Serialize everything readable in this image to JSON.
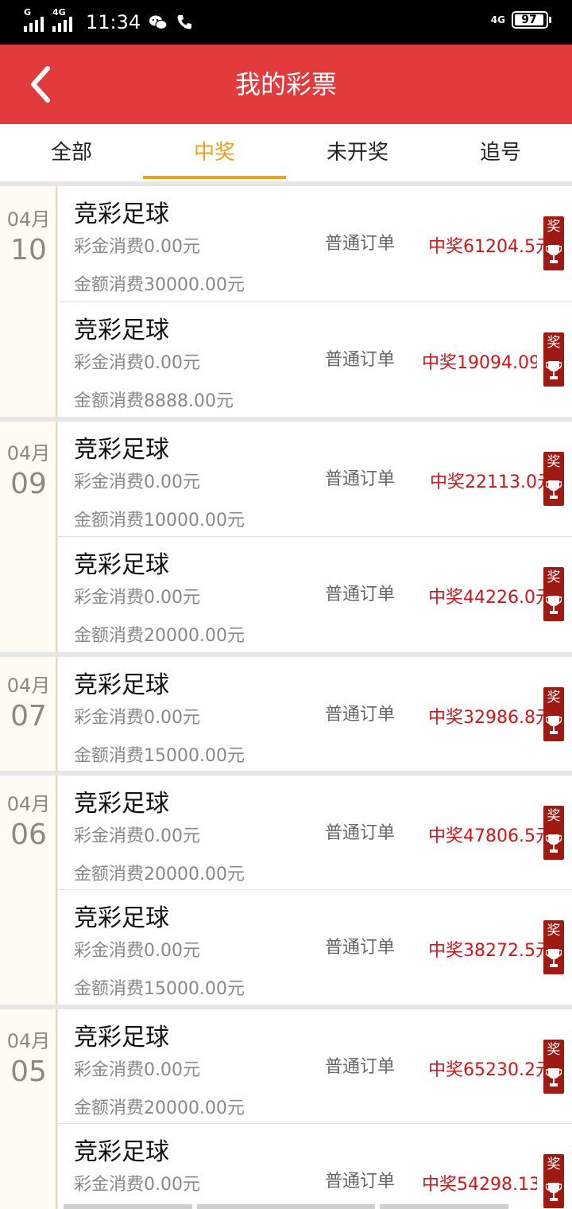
{
  "status_bar": {
    "time": "11:34",
    "signal1_label": "G",
    "signal2_label": "4G",
    "network": "4G",
    "battery": "97"
  },
  "header": {
    "title": "我的彩票"
  },
  "tabs": [
    {
      "label": "全部",
      "active": false
    },
    {
      "label": "中奖",
      "active": true
    },
    {
      "label": "未开奖",
      "active": false
    },
    {
      "label": "追号",
      "active": false
    }
  ],
  "groups": [
    {
      "month": "04月",
      "day": "10",
      "items": [
        {
          "title": "竞彩足球",
          "bonus": "彩金消费0.00元",
          "amount": "金额消费30000.00元",
          "order_type": "普通订单",
          "prize": "中奖61204.5元",
          "badge": "奖"
        },
        {
          "title": "竞彩足球",
          "bonus": "彩金消费0.00元",
          "amount": "金额消费8888.00元",
          "order_type": "普通订单",
          "prize": "中奖19094.09元",
          "badge": "奖"
        }
      ]
    },
    {
      "month": "04月",
      "day": "09",
      "items": [
        {
          "title": "竞彩足球",
          "bonus": "彩金消费0.00元",
          "amount": "金额消费10000.00元",
          "order_type": "普通订单",
          "prize": "中奖22113.0元",
          "badge": "奖"
        },
        {
          "title": "竞彩足球",
          "bonus": "彩金消费0.00元",
          "amount": "金额消费20000.00元",
          "order_type": "普通订单",
          "prize": "中奖44226.0元",
          "badge": "奖"
        }
      ]
    },
    {
      "month": "04月",
      "day": "07",
      "items": [
        {
          "title": "竞彩足球",
          "bonus": "彩金消费0.00元",
          "amount": "金额消费15000.00元",
          "order_type": "普通订单",
          "prize": "中奖32986.8元",
          "badge": "奖"
        }
      ]
    },
    {
      "month": "04月",
      "day": "06",
      "items": [
        {
          "title": "竞彩足球",
          "bonus": "彩金消费0.00元",
          "amount": "金额消费20000.00元",
          "order_type": "普通订单",
          "prize": "中奖47806.5元",
          "badge": "奖"
        },
        {
          "title": "竞彩足球",
          "bonus": "彩金消费0.00元",
          "amount": "金额消费15000.00元",
          "order_type": "普通订单",
          "prize": "中奖38272.5元",
          "badge": "奖"
        }
      ]
    },
    {
      "month": "04月",
      "day": "05",
      "items": [
        {
          "title": "竞彩足球",
          "bonus": "彩金消费0.00元",
          "amount": "金额消费20000.00元",
          "order_type": "普通订单",
          "prize": "中奖65230.2元",
          "badge": "奖"
        },
        {
          "title": "竞彩足球",
          "bonus": "彩金消费0.00元",
          "amount": "",
          "order_type": "普通订单",
          "prize": "中奖54298.13元",
          "badge": "奖"
        }
      ]
    }
  ]
}
